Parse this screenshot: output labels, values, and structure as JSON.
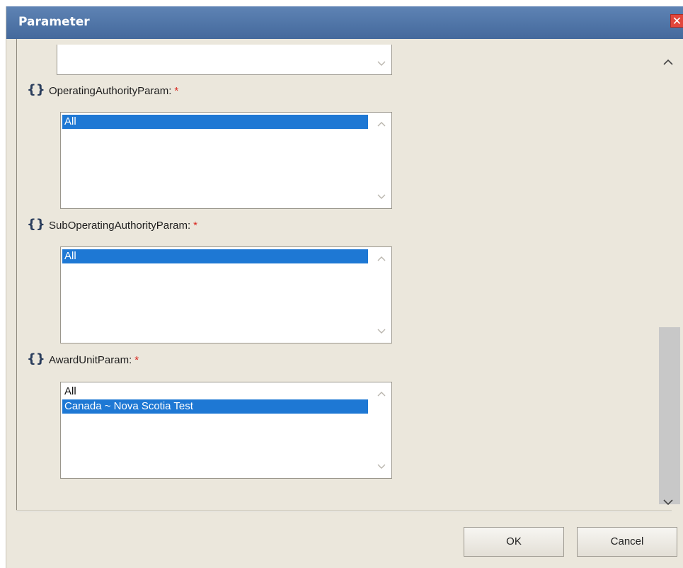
{
  "dialog": {
    "title": "Parameter",
    "close_glyph": "✕"
  },
  "params": [
    {
      "label": "OperatingAuthorityParam:",
      "required": "*",
      "options": [
        {
          "text": "All",
          "selected": true
        }
      ]
    },
    {
      "label": "SubOperatingAuthorityParam:",
      "required": "*",
      "options": [
        {
          "text": "All",
          "selected": true
        }
      ]
    },
    {
      "label": "AwardUnitParam:",
      "required": "*",
      "options": [
        {
          "text": "All",
          "selected": false
        },
        {
          "text": "Canada ~ Nova Scotia Test",
          "selected": true
        }
      ]
    }
  ],
  "param_icon": "{}",
  "icons": {
    "param": "curly-braces-icon",
    "scroll_up": "chevron-up-icon",
    "scroll_down": "chevron-down-icon",
    "close": "close-icon"
  },
  "buttons": {
    "ok": "OK",
    "cancel": "Cancel"
  },
  "colors": {
    "titlebar": "#4f75a8",
    "selection": "#1e78d4",
    "required": "#d8271f",
    "dialog_bg": "#ebe7dc"
  }
}
